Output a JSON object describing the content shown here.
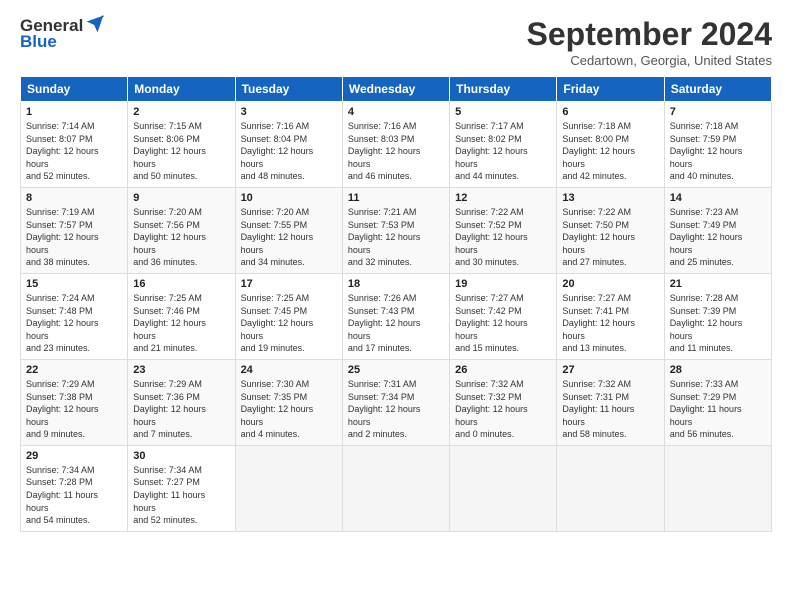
{
  "header": {
    "logo_general": "General",
    "logo_blue": "Blue",
    "title": "September 2024",
    "location": "Cedartown, Georgia, United States"
  },
  "weekdays": [
    "Sunday",
    "Monday",
    "Tuesday",
    "Wednesday",
    "Thursday",
    "Friday",
    "Saturday"
  ],
  "weeks": [
    [
      {
        "day": "1",
        "sunrise": "7:14 AM",
        "sunset": "8:07 PM",
        "daylight": "12 hours and 52 minutes."
      },
      {
        "day": "2",
        "sunrise": "7:15 AM",
        "sunset": "8:06 PM",
        "daylight": "12 hours and 50 minutes."
      },
      {
        "day": "3",
        "sunrise": "7:16 AM",
        "sunset": "8:04 PM",
        "daylight": "12 hours and 48 minutes."
      },
      {
        "day": "4",
        "sunrise": "7:16 AM",
        "sunset": "8:03 PM",
        "daylight": "12 hours and 46 minutes."
      },
      {
        "day": "5",
        "sunrise": "7:17 AM",
        "sunset": "8:02 PM",
        "daylight": "12 hours and 44 minutes."
      },
      {
        "day": "6",
        "sunrise": "7:18 AM",
        "sunset": "8:00 PM",
        "daylight": "12 hours and 42 minutes."
      },
      {
        "day": "7",
        "sunrise": "7:18 AM",
        "sunset": "7:59 PM",
        "daylight": "12 hours and 40 minutes."
      }
    ],
    [
      {
        "day": "8",
        "sunrise": "7:19 AM",
        "sunset": "7:57 PM",
        "daylight": "12 hours and 38 minutes."
      },
      {
        "day": "9",
        "sunrise": "7:20 AM",
        "sunset": "7:56 PM",
        "daylight": "12 hours and 36 minutes."
      },
      {
        "day": "10",
        "sunrise": "7:20 AM",
        "sunset": "7:55 PM",
        "daylight": "12 hours and 34 minutes."
      },
      {
        "day": "11",
        "sunrise": "7:21 AM",
        "sunset": "7:53 PM",
        "daylight": "12 hours and 32 minutes."
      },
      {
        "day": "12",
        "sunrise": "7:22 AM",
        "sunset": "7:52 PM",
        "daylight": "12 hours and 30 minutes."
      },
      {
        "day": "13",
        "sunrise": "7:22 AM",
        "sunset": "7:50 PM",
        "daylight": "12 hours and 27 minutes."
      },
      {
        "day": "14",
        "sunrise": "7:23 AM",
        "sunset": "7:49 PM",
        "daylight": "12 hours and 25 minutes."
      }
    ],
    [
      {
        "day": "15",
        "sunrise": "7:24 AM",
        "sunset": "7:48 PM",
        "daylight": "12 hours and 23 minutes."
      },
      {
        "day": "16",
        "sunrise": "7:25 AM",
        "sunset": "7:46 PM",
        "daylight": "12 hours and 21 minutes."
      },
      {
        "day": "17",
        "sunrise": "7:25 AM",
        "sunset": "7:45 PM",
        "daylight": "12 hours and 19 minutes."
      },
      {
        "day": "18",
        "sunrise": "7:26 AM",
        "sunset": "7:43 PM",
        "daylight": "12 hours and 17 minutes."
      },
      {
        "day": "19",
        "sunrise": "7:27 AM",
        "sunset": "7:42 PM",
        "daylight": "12 hours and 15 minutes."
      },
      {
        "day": "20",
        "sunrise": "7:27 AM",
        "sunset": "7:41 PM",
        "daylight": "12 hours and 13 minutes."
      },
      {
        "day": "21",
        "sunrise": "7:28 AM",
        "sunset": "7:39 PM",
        "daylight": "12 hours and 11 minutes."
      }
    ],
    [
      {
        "day": "22",
        "sunrise": "7:29 AM",
        "sunset": "7:38 PM",
        "daylight": "12 hours and 9 minutes."
      },
      {
        "day": "23",
        "sunrise": "7:29 AM",
        "sunset": "7:36 PM",
        "daylight": "12 hours and 7 minutes."
      },
      {
        "day": "24",
        "sunrise": "7:30 AM",
        "sunset": "7:35 PM",
        "daylight": "12 hours and 4 minutes."
      },
      {
        "day": "25",
        "sunrise": "7:31 AM",
        "sunset": "7:34 PM",
        "daylight": "12 hours and 2 minutes."
      },
      {
        "day": "26",
        "sunrise": "7:32 AM",
        "sunset": "7:32 PM",
        "daylight": "12 hours and 0 minutes."
      },
      {
        "day": "27",
        "sunrise": "7:32 AM",
        "sunset": "7:31 PM",
        "daylight": "11 hours and 58 minutes."
      },
      {
        "day": "28",
        "sunrise": "7:33 AM",
        "sunset": "7:29 PM",
        "daylight": "11 hours and 56 minutes."
      }
    ],
    [
      {
        "day": "29",
        "sunrise": "7:34 AM",
        "sunset": "7:28 PM",
        "daylight": "11 hours and 54 minutes."
      },
      {
        "day": "30",
        "sunrise": "7:34 AM",
        "sunset": "7:27 PM",
        "daylight": "11 hours and 52 minutes."
      },
      null,
      null,
      null,
      null,
      null
    ]
  ]
}
